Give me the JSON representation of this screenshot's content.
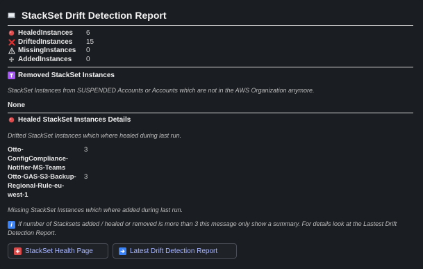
{
  "header": {
    "title": "StackSet Drift Detection Report"
  },
  "stats": [
    {
      "name": "HealedInstances",
      "value": "6"
    },
    {
      "name": "DriftedInstances",
      "value": "15"
    },
    {
      "name": "MissingInstances",
      "value": "0"
    },
    {
      "name": "AddedInstances",
      "value": "0"
    }
  ],
  "removed": {
    "heading": "Removed StackSet Instances",
    "description": "StackSet Instances from SUSPENDED Accounts or Accounts which are not in the AWS Organization anymore.",
    "value": "None"
  },
  "healed": {
    "heading": "Healed StackSet Instances Details",
    "drifted_description": "Drifted StackSet Instances which where healed during last run.",
    "instances": [
      {
        "name": "Otto-ConfigCompliance-Notifier-MS-Teams",
        "value": "3"
      },
      {
        "name": "Otto-GAS-S3-Backup-Regional-Rule-eu-west-1",
        "value": "3"
      }
    ],
    "missing_description": "Missing StackSet Instances which where added during last run."
  },
  "note": "If number of Stacksets added / healed or removed is more than 3 this message only show a summary. For details look at the Lastest Drift Detection Report.",
  "buttons": {
    "health": "StackSet Health Page",
    "report": "Latest Drift Detection Report"
  },
  "colors": {
    "background": "#1a1d21",
    "link": "#a9b7ff",
    "healed_dot": "#e24b4b",
    "drifted_x": "#e03131"
  },
  "icons": {
    "title": "computer-icon",
    "healed": "red-dot-icon",
    "drifted": "red-x-icon",
    "missing": "warning-icon",
    "added": "plus-icon",
    "removed": "trash-badge-icon",
    "info": "info-icon",
    "health": "hospital-icon",
    "report": "arrow-right-icon"
  }
}
